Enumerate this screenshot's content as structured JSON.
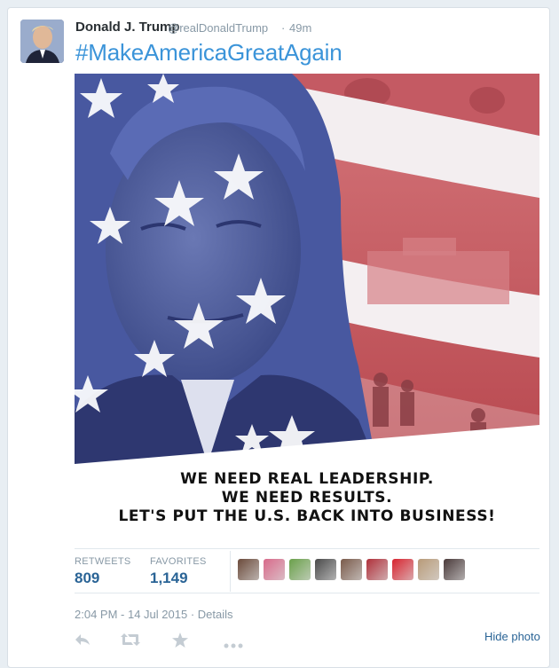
{
  "tweet": {
    "author_name": "Donald J. Trump",
    "handle": "@realDonaldTrump",
    "separator": "·",
    "time_ago": "49m",
    "text": "#MakeAmericaGreatAgain",
    "slogan_lines": [
      "WE NEED REAL LEADERSHIP.",
      "WE NEED RESULTS.",
      "LET'S PUT THE U.S. BACK INTO BUSINESS!"
    ]
  },
  "stats": {
    "retweets_label": "RETWEETS",
    "retweets_value": "809",
    "favorites_label": "FAVORITES",
    "favorites_value": "1,149"
  },
  "favorited_by": [
    {
      "color": "#6b4a3a"
    },
    {
      "color": "#d86a8a"
    },
    {
      "color": "#6aa04a"
    },
    {
      "color": "#4a4a4a"
    },
    {
      "color": "#7a5a4a"
    },
    {
      "color": "#b0303a"
    },
    {
      "color": "#d8242f"
    },
    {
      "color": "#b89a78"
    },
    {
      "color": "#4a3a3a"
    }
  ],
  "footer": {
    "timestamp": "2:04 PM - 14 Jul 2015",
    "details_sep": " · ",
    "details_label": "Details",
    "hide_photo": "Hide photo"
  },
  "icons": [
    "reply-icon",
    "retweet-icon",
    "favorite-icon",
    "more-icon"
  ],
  "colors": {
    "link": "#3b94d9",
    "stat_value": "#2a6496",
    "muted": "#8899a6",
    "flag_red": "#c9474e",
    "flag_blue": "#4a5aa0"
  }
}
